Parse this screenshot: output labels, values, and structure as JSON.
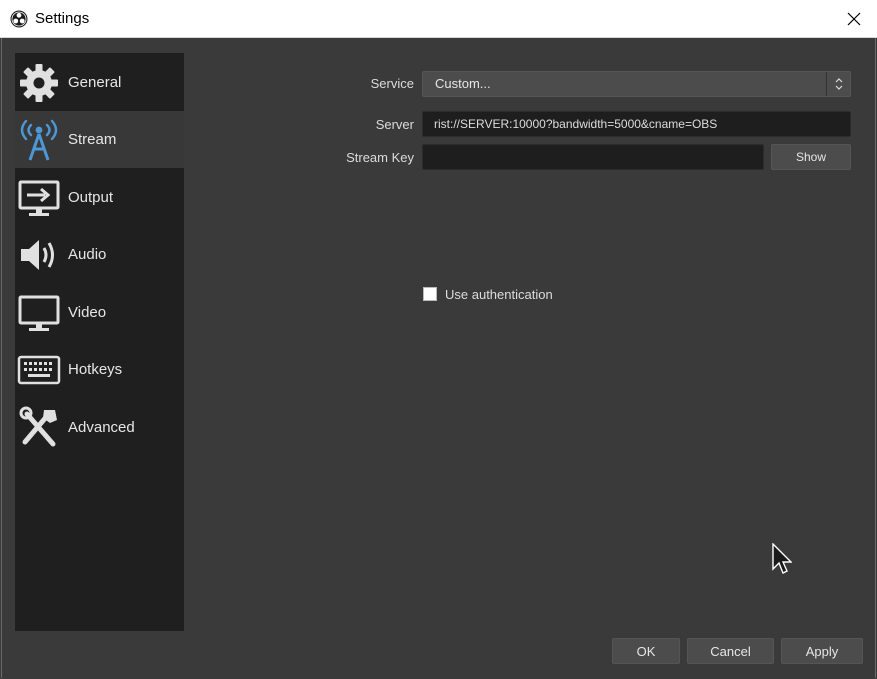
{
  "window": {
    "title": "Settings"
  },
  "sidebar": {
    "items": [
      {
        "label": "General",
        "icon": "gear-icon"
      },
      {
        "label": "Stream",
        "icon": "broadcast-antenna-icon",
        "active": true
      },
      {
        "label": "Output",
        "icon": "output-monitor-icon"
      },
      {
        "label": "Audio",
        "icon": "speaker-icon"
      },
      {
        "label": "Video",
        "icon": "monitor-icon"
      },
      {
        "label": "Hotkeys",
        "icon": "keyboard-icon"
      },
      {
        "label": "Advanced",
        "icon": "tools-icon"
      }
    ]
  },
  "stream": {
    "service_label": "Service",
    "service_value": "Custom...",
    "server_label": "Server",
    "server_value": "rist://SERVER:10000?bandwidth=5000&cname=OBS",
    "stream_key_label": "Stream Key",
    "stream_key_value": "",
    "show_label": "Show",
    "use_auth_label": "Use authentication",
    "use_auth_checked": false
  },
  "footer": {
    "ok_label": "OK",
    "cancel_label": "Cancel",
    "apply_label": "Apply"
  },
  "colors": {
    "background": "#3a3a3a",
    "sidebar": "#1f1f1f",
    "active_item": "#383838",
    "field": "#1e1e1e",
    "button": "#4c4c4c"
  }
}
